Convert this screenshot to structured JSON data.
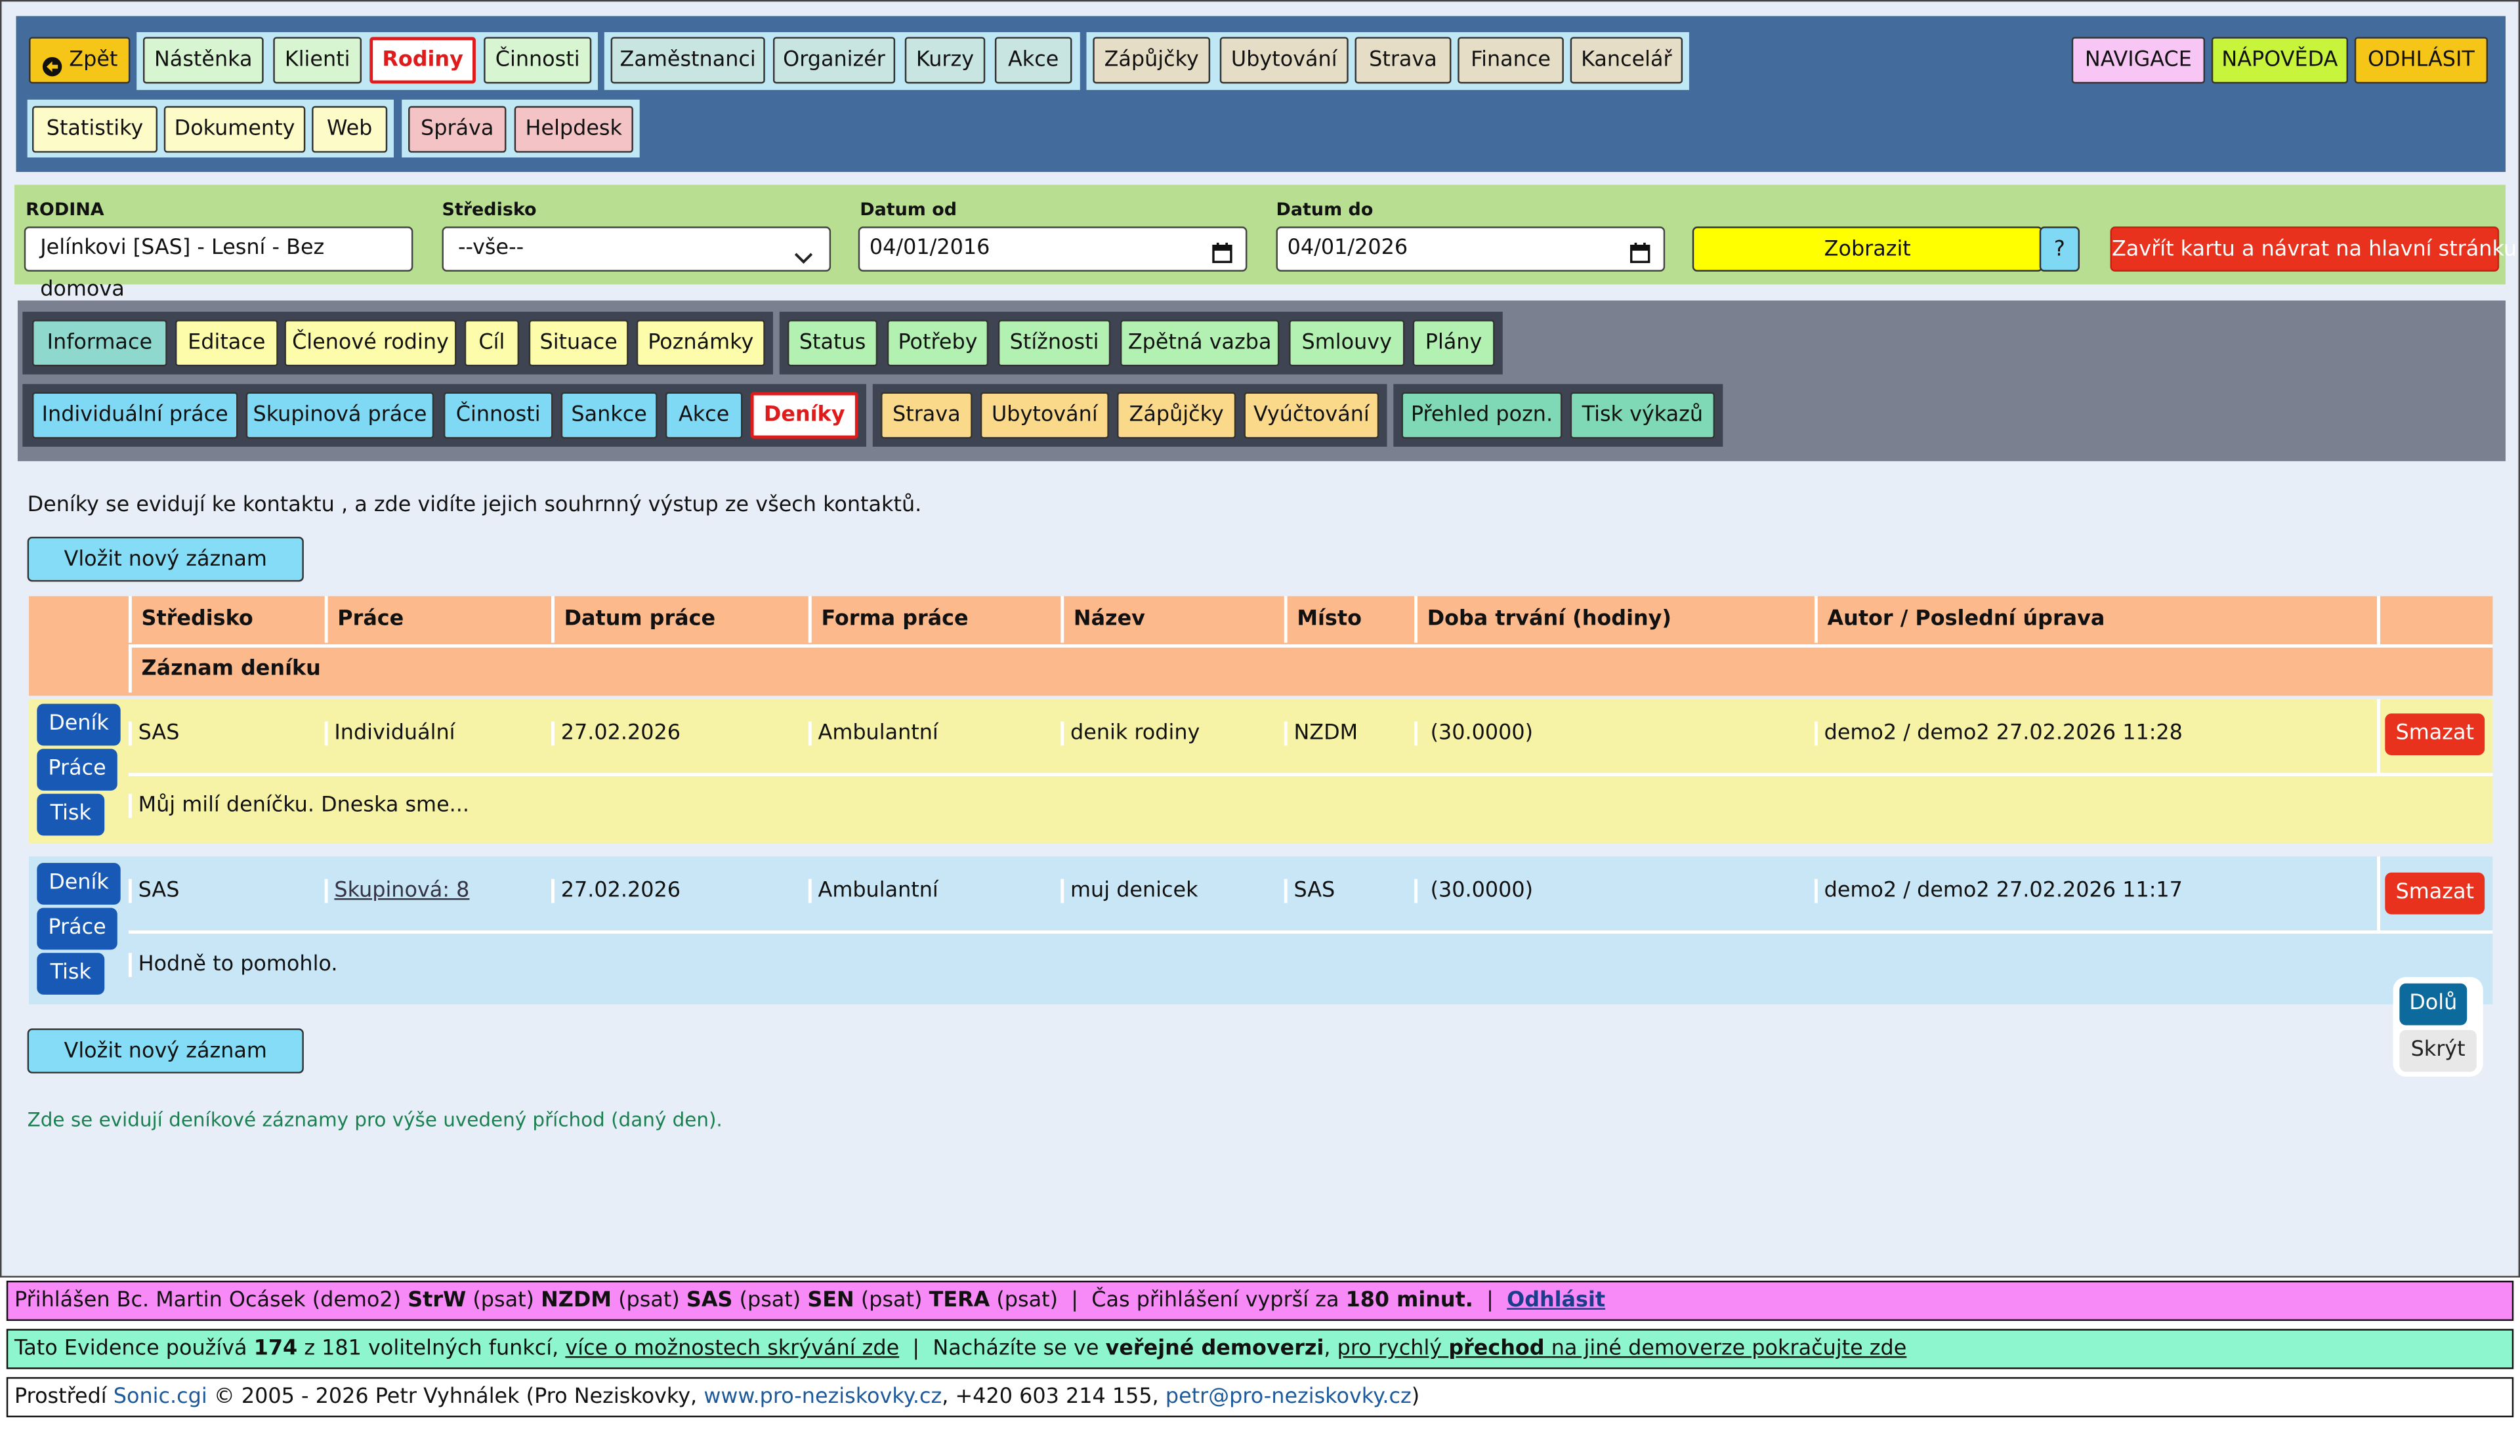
{
  "topnav": {
    "back": "Zpět",
    "group1": [
      "Nástěnka",
      "Klienti",
      "Rodiny",
      "Činnosti"
    ],
    "group2": [
      "Zaměstnanci",
      "Organizér",
      "Kurzy",
      "Akce"
    ],
    "group3": [
      "Zápůjčky",
      "Ubytování",
      "Strava",
      "Finance",
      "Kancelář"
    ],
    "right": [
      "NAVIGACE",
      "NÁPOVĚDA",
      "ODHLÁSIT"
    ],
    "row2a": [
      "Statistiky",
      "Dokumenty",
      "Web"
    ],
    "row2b": [
      "Správa",
      "Helpdesk"
    ]
  },
  "filter": {
    "rodina_label": "RODINA",
    "rodina_value": "Jelínkovi [SAS] - Lesní - Bez domova",
    "stredisko_label": "Středisko",
    "stredisko_value": "--vše--",
    "datum_od_label": "Datum od",
    "datum_od_value": "04/01/2016",
    "datum_do_label": "Datum do",
    "datum_do_value": "04/01/2026",
    "show_button": "Zobrazit",
    "help_button": "?",
    "close_button": "Zavřít kartu a návrat na hlavní stránku"
  },
  "tabs": {
    "row1a": [
      "Informace",
      "Editace",
      "Členové rodiny",
      "Cíl",
      "Situace",
      "Poznámky"
    ],
    "row1b": [
      "Status",
      "Potřeby",
      "Stížnosti",
      "Zpětná vazba",
      "Smlouvy",
      "Plány"
    ],
    "row2a": [
      "Individuální práce",
      "Skupinová práce",
      "Činnosti",
      "Sankce",
      "Akce",
      "Deníky"
    ],
    "row2b": [
      "Strava",
      "Ubytování",
      "Zápůjčky",
      "Vyúčtování"
    ],
    "row2c": [
      "Přehled pozn.",
      "Tisk výkazů"
    ]
  },
  "content": {
    "intro": "Deníky se evidují ke kontaktu , a zde vidíte jejich souhrnný výstup ze všech kontaktů.",
    "add_button": "Vložit nový záznam",
    "add_button_bottom": "Vložit nový záznam",
    "note": "Zde se evidují deníkové záznamy pro výše uvedený příchod (daný den)."
  },
  "table": {
    "headers": [
      "Středisko",
      "Práce",
      "Datum práce",
      "Forma práce",
      "Název",
      "Místo",
      "Doba trvání (hodiny)",
      "Autor / Poslední úprava"
    ],
    "subheader": "Záznam deníku",
    "row_buttons": [
      "Deník",
      "Práce",
      "Tisk"
    ],
    "delete_label": "Smazat",
    "rows": [
      {
        "stredisko": "SAS",
        "prace": "Individuální",
        "datum": "27.02.2026",
        "forma": "Ambulantní",
        "nazev": "denik rodiny",
        "misto": "NZDM",
        "doba": "(30.0000)",
        "autor": "demo2 / demo2 27.02.2026 11:28",
        "zaznam": "Můj milí deníčku. Dneska sme..."
      },
      {
        "stredisko": "SAS",
        "prace": "Skupinová: 8",
        "datum": "27.02.2026",
        "forma": "Ambulantní",
        "nazev": "muj denicek",
        "misto": "SAS",
        "doba": "(30.0000)",
        "autor": "demo2 / demo2 27.02.2026 11:17",
        "zaznam": "Hodně to pomohlo."
      }
    ]
  },
  "floating": {
    "down": "Dolů",
    "hide": "Skrýt"
  },
  "footer": {
    "f1_prefix": "Přihlášen Bc. Martin Ocásek (demo2)",
    "f1_roles": [
      {
        "code": "StrW",
        "perm": "(psat)"
      },
      {
        "code": "NZDM",
        "perm": "(psat)"
      },
      {
        "code": "SAS",
        "perm": "(psat)"
      },
      {
        "code": "SEN",
        "perm": "(psat)"
      },
      {
        "code": "TERA",
        "perm": "(psat)"
      }
    ],
    "f1_session": "Čas přihlášení vyprší za",
    "f1_minutes": "180 minut.",
    "f1_logout": "Odhlásit",
    "f2_a": "Tato Evidence používá",
    "f2_count": "174",
    "f2_b": "z 181 volitelných funkcí,",
    "f2_link1": "více o možnostech skrývání zde",
    "f2_c": "Nacházíte se ve",
    "f2_bold": "veřejné demoverzi",
    "f2_link2_a": "pro rychlý",
    "f2_link2_b": "přechod",
    "f2_link2_c": "na jiné demoverze pokračujte zde",
    "f3_a": "Prostředí",
    "f3_sonic": "Sonic.cgi",
    "f3_b": "© 2005 - 2026 Petr Vyhnálek (Pro Neziskovky,",
    "f3_web": "www.pro-neziskovky.cz",
    "f3_c": ", +420 603 214 155,",
    "f3_mail": "petr@pro-neziskovky.cz",
    "f3_d": ")"
  },
  "colors": {
    "nav_bg": "#436b9c",
    "filter_bg": "#b8de92",
    "tab_bg": "#7b8090",
    "header_bg": "#fbb98c",
    "row1_bg": "#f7f3a6",
    "row2_bg": "#c8e6f6",
    "active_red": "#e01b1b"
  }
}
